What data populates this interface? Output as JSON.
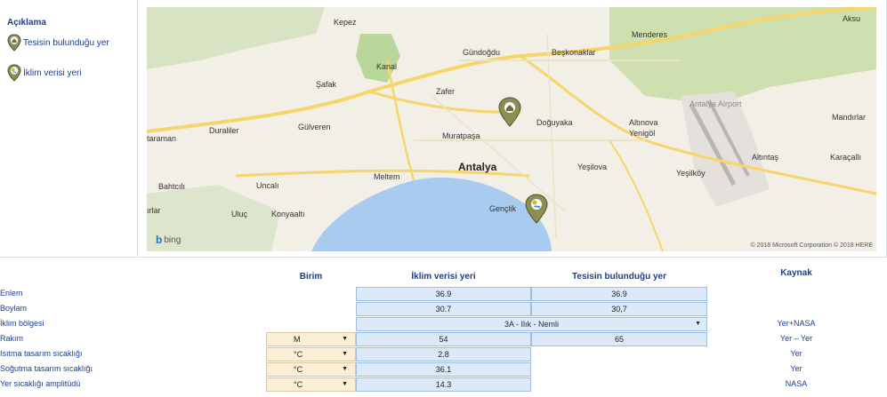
{
  "legend": {
    "title": "Açıklama",
    "items": [
      {
        "label": "Tesisin bulunduğu yer",
        "icon": "home-pin-icon"
      },
      {
        "label": "İklim verisi yeri",
        "icon": "weather-pin-icon"
      }
    ]
  },
  "map": {
    "places": {
      "kepez": "Kepez",
      "aksu": "Aksu",
      "gundogdu": "Gündoğdu",
      "menderes": "Menderes",
      "besk": "Beşkonaklar",
      "kanal": "Kanal",
      "salak": "Şafak",
      "zafer": "Zafer",
      "gulveren": "Gülveren",
      "duraliler": "Duraliler",
      "karaman": "taraman",
      "muratpasa": "Muratpaşa",
      "doguyaka": "Doğuyaka",
      "altinova": "Altınova",
      "yenigol": "Yenigöl",
      "airport": "Antalya Airport",
      "mandirlar": "Mandırlar",
      "antalya": "Antalya",
      "yesilova": "Yeşilova",
      "altintas": "Altıntaş",
      "karacali": "Karaçallı",
      "bahtcili": "Bahtcılı",
      "uncali": "Uncalı",
      "meltem": "Meltem",
      "yesilkoy": "Yeşilköy",
      "arlar": "ırlar",
      "uluc": "Uluç",
      "konyaalti": "Konyaaltı",
      "genclik": "Gençlik"
    },
    "bing_label": "bing",
    "copyright": "© 2018 Microsoft Corporation © 2018 HERE"
  },
  "table": {
    "headers": {
      "unit": "Birim",
      "climate": "İklim verisi yeri",
      "site": "Tesisin bulunduğu yer",
      "source": "Kaynak"
    },
    "rows": {
      "lat": {
        "label": "Enlem",
        "climate": "36.9",
        "site": "36.9",
        "source": ""
      },
      "lon": {
        "label": "Boylam",
        "climate": "30.7",
        "site": "30,7",
        "source": ""
      },
      "zone": {
        "label": "İklim bölgesi",
        "value": "3A - Ilık - Nemli",
        "source": "Yer+NASA"
      },
      "elev": {
        "label": "Rakım",
        "unit": "M",
        "climate": "54",
        "site": "65",
        "source": "Yer – Yer"
      },
      "heat": {
        "label": "Isıtma tasarım sıcaklığı",
        "unit": "°C",
        "climate": "2.8",
        "source": "Yer"
      },
      "cool": {
        "label": "Soğutma tasarım sıcaklığı",
        "unit": "°C",
        "climate": "36.1",
        "source": "Yer"
      },
      "amp": {
        "label": "Yer sıcaklığı amplitüdü",
        "unit": "°C",
        "climate": "14.3",
        "source": "NASA"
      }
    }
  },
  "colors": {
    "label_blue": "#1b3f8c",
    "cell_blue": "#dbe9f9",
    "unit_tan": "#fbeed4",
    "sea": "#a9cbf0",
    "road": "#f6d56a"
  }
}
